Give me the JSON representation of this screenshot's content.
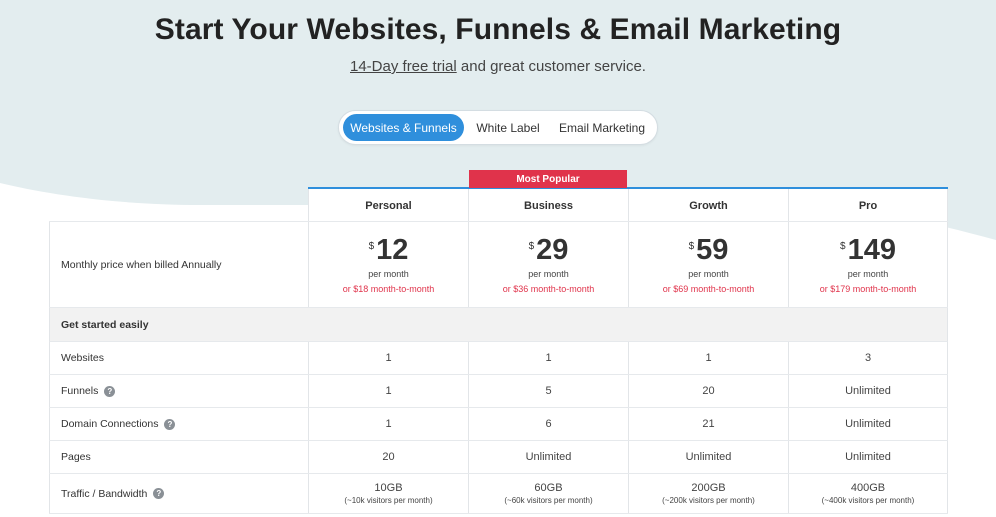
{
  "hero": {
    "title": "Start Your Websites, Funnels & Email Marketing",
    "subtitle_link": "14-Day free trial",
    "subtitle_rest": " and great customer service.",
    "background_color": "#e3edef"
  },
  "toggle": {
    "options": [
      "Websites & Funnels",
      "White Label",
      "Email Marketing"
    ],
    "active_color": "#2f8fdc"
  },
  "badge": {
    "label": "Most Popular",
    "color": "#e0334b"
  },
  "plans": [
    {
      "name": "Personal",
      "currency": "$",
      "price": "12",
      "per": "per month",
      "mtm": "or $18 month-to-month"
    },
    {
      "name": "Business",
      "currency": "$",
      "price": "29",
      "per": "per month",
      "mtm": "or $36 month-to-month"
    },
    {
      "name": "Growth",
      "currency": "$",
      "price": "59",
      "per": "per month",
      "mtm": "or $69 month-to-month"
    },
    {
      "name": "Pro",
      "currency": "$",
      "price": "149",
      "per": "per month",
      "mtm": "or $179 month-to-month"
    }
  ],
  "table": {
    "price_label": "Monthly price when billed Annually",
    "section_title": "Get started easily",
    "help_glyph": "?",
    "rows": [
      {
        "label": "Websites",
        "values": [
          "1",
          "1",
          "1",
          "3"
        ]
      },
      {
        "label": "Funnels",
        "values": [
          "1",
          "5",
          "20",
          "Unlimited"
        ]
      },
      {
        "label": "Domain Connections",
        "values": [
          "1",
          "6",
          "21",
          "Unlimited"
        ]
      },
      {
        "label": "Pages",
        "values": [
          "20",
          "Unlimited",
          "Unlimited",
          "Unlimited"
        ]
      }
    ],
    "traffic": {
      "label": "Traffic / Bandwidth",
      "values": [
        "10GB",
        "60GB",
        "200GB",
        "400GB"
      ],
      "notes": [
        "(~10k visitors per month)",
        "(~60k visitors per month)",
        "(~200k visitors per month)",
        "(~400k visitors per month)"
      ]
    }
  }
}
